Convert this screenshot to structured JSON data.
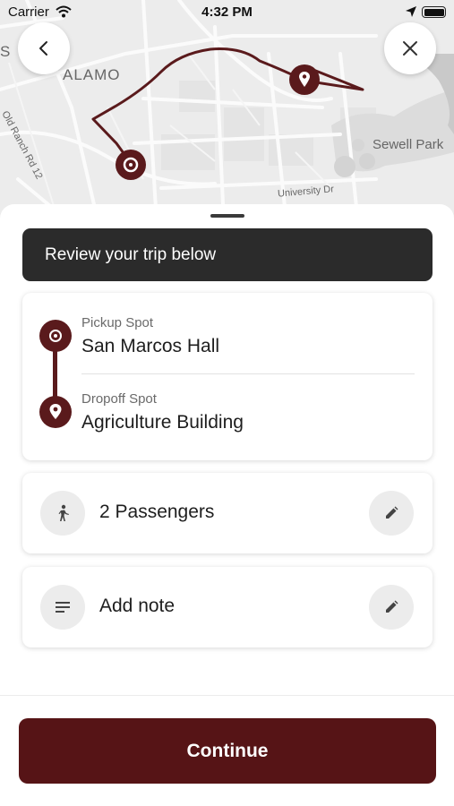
{
  "status_bar": {
    "carrier": "Carrier",
    "time": "4:32 PM"
  },
  "map": {
    "labels": {
      "alamo": "ALAMO",
      "partial_s": "S",
      "sewell_park": "Sewell Park",
      "old_ranch_rd": "Old Ranch Rd 12",
      "university_dr": "University Dr"
    },
    "route_color": "#5a1a1c",
    "back_icon": "chevron-left-icon",
    "close_icon": "close-icon"
  },
  "banner": {
    "text": "Review your trip below"
  },
  "trip": {
    "pickup_label": "Pickup Spot",
    "pickup_value": "San Marcos Hall",
    "dropoff_label": "Dropoff Spot",
    "dropoff_value": "Agriculture Building"
  },
  "passengers": {
    "text": "2 Passengers",
    "icon": "person-icon",
    "edit_icon": "pencil-icon"
  },
  "note": {
    "text": "Add note",
    "icon": "notes-icon",
    "edit_icon": "pencil-icon"
  },
  "footer": {
    "continue_label": "Continue",
    "accent_color": "#561416"
  }
}
